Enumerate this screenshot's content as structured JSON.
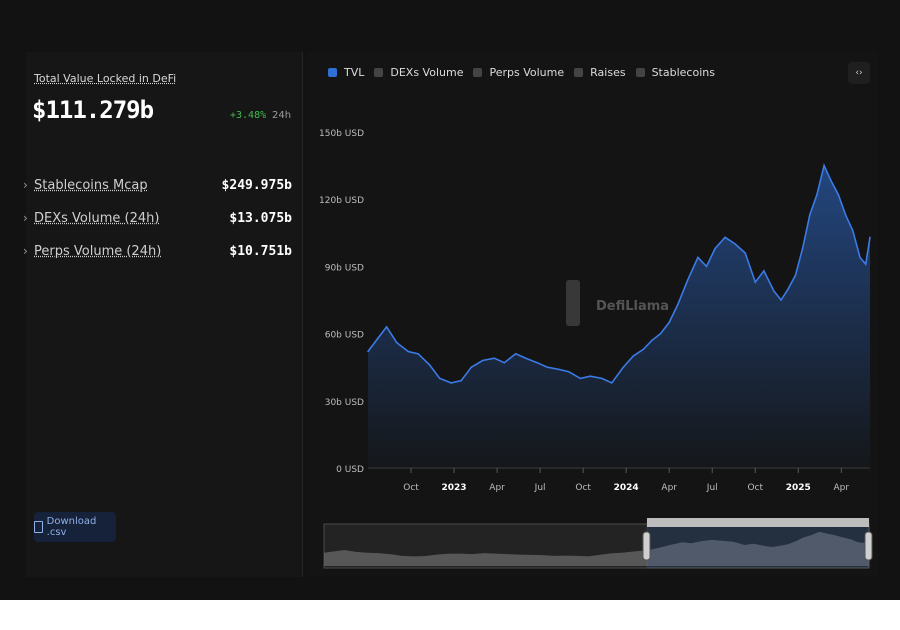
{
  "summary": {
    "tvl_label": "Total Value Locked in DeFi",
    "tvl_value": "$111.279b",
    "tvl_change": "+3.48%",
    "tvl_period": "24h",
    "metrics": [
      {
        "label": "Stablecoins Mcap",
        "value": "$249.975b"
      },
      {
        "label": "DEXs Volume (24h)",
        "value": "$13.075b"
      },
      {
        "label": "Perps Volume (24h)",
        "value": "$10.751b"
      }
    ],
    "download_label": "Download .csv"
  },
  "legend": [
    {
      "label": "TVL",
      "active": true
    },
    {
      "label": "DEXs Volume",
      "active": false
    },
    {
      "label": "Perps Volume",
      "active": false
    },
    {
      "label": "Raises",
      "active": false
    },
    {
      "label": "Stablecoins",
      "active": false
    }
  ],
  "watermark": "DefiLlama",
  "colors": {
    "accent": "#2f6fd6",
    "positive": "#3fbb4e"
  },
  "chart_data": {
    "type": "area",
    "title": "",
    "xlabel": "",
    "ylabel": "",
    "ylim": [
      0,
      150
    ],
    "y_ticks": [
      0,
      30,
      60,
      90,
      120,
      150
    ],
    "y_tick_labels": [
      "0 USD",
      "30b USD",
      "60b USD",
      "90b USD",
      "120b USD",
      "150b USD"
    ],
    "x_tick_labels": [
      "Oct",
      "2023",
      "Apr",
      "Jul",
      "Oct",
      "2024",
      "Apr",
      "Jul",
      "Oct",
      "2025",
      "Apr"
    ],
    "x_tick_months": [
      3,
      6,
      9,
      12,
      15,
      18,
      21,
      24,
      27,
      30,
      33
    ],
    "x_range_months": [
      0,
      35
    ],
    "series": [
      {
        "name": "TVL",
        "x_months": [
          0,
          0.7,
          1.3,
          2,
          2.8,
          3.5,
          4.3,
          5,
          5.8,
          6.5,
          7.2,
          8,
          8.8,
          9.5,
          10.3,
          11,
          11.8,
          12.5,
          13.3,
          14,
          14.8,
          15.5,
          16.3,
          17,
          17.8,
          18.5,
          19.2,
          19.8,
          20.4,
          21,
          21.6,
          22.3,
          23,
          23.6,
          24.2,
          24.9,
          25.6,
          26.3,
          27,
          27.6,
          28.3,
          28.8,
          29.3,
          29.8,
          30.3,
          30.8,
          31.3,
          31.8,
          32.3,
          32.8,
          33.3,
          33.8,
          34.3,
          34.7,
          35
        ],
        "values": [
          52,
          58,
          63,
          56,
          52,
          51,
          46,
          40,
          38,
          39,
          45,
          48,
          49,
          47,
          51,
          49,
          47,
          45,
          44,
          43,
          40,
          41,
          40,
          38,
          45,
          50,
          53,
          57,
          60,
          65,
          73,
          84,
          94,
          90,
          98,
          103,
          100,
          96,
          83,
          88,
          79,
          75,
          80,
          86,
          98,
          113,
          122,
          135,
          128,
          122,
          113,
          106,
          94,
          91,
          103
        ]
      }
    ]
  }
}
